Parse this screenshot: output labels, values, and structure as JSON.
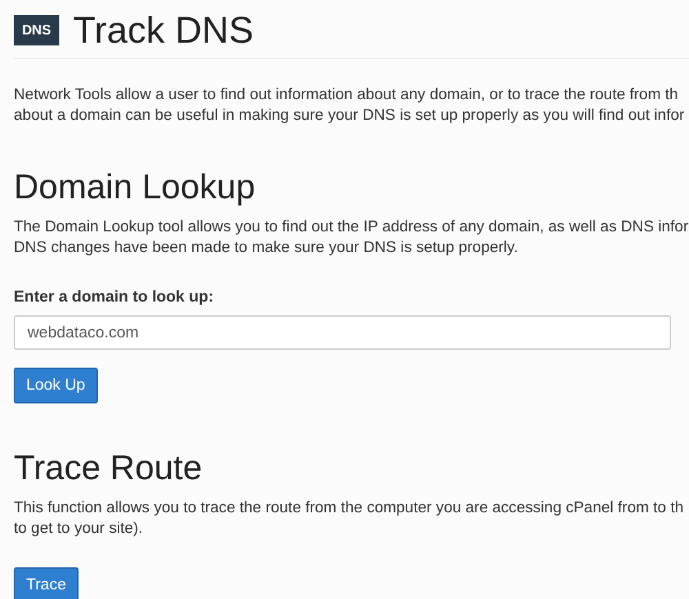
{
  "header": {
    "icon_text": "DNS",
    "title": "Track DNS"
  },
  "intro": [
    "Network Tools allow a user to find out information about any domain, or to trace the route from th",
    "about a domain can be useful in making sure your DNS is set up properly as you will find out infor"
  ],
  "sections": [
    {
      "kind": "lookup",
      "heading": "Domain Lookup",
      "lines": [
        "The Domain Lookup tool allows you to find out the IP address of any domain, as well as DNS infor",
        "DNS changes have been made to make sure your DNS is setup properly."
      ],
      "field_label": "Enter a domain to look up:",
      "field_value": "webdataco.com",
      "button": "Look Up"
    },
    {
      "kind": "trace",
      "heading": "Trace Route",
      "lines": [
        "This function allows you to trace the route from the computer you are accessing cPanel from to th",
        "to get to your site)."
      ],
      "button": "Trace"
    }
  ]
}
